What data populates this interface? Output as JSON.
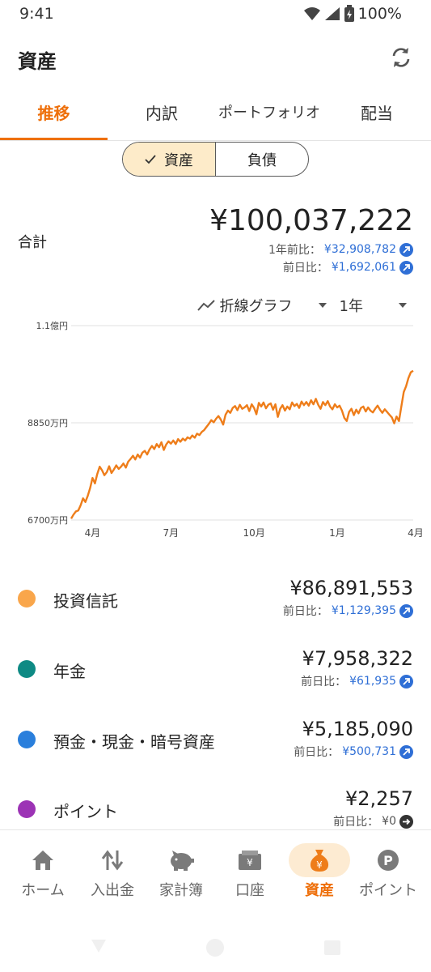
{
  "status_bar": {
    "time": "9:41",
    "battery": "100%"
  },
  "header": {
    "title": "資産"
  },
  "tabs": [
    {
      "label": "推移",
      "active": true
    },
    {
      "label": "内訳",
      "active": false
    },
    {
      "label": "ポートフォリオ",
      "active": false
    },
    {
      "label": "配当",
      "active": false
    }
  ],
  "segment": {
    "assets_label": "資産",
    "liabilities_label": "負債",
    "selected": "資産"
  },
  "summary": {
    "total_label": "合計",
    "total_value": "¥100,037,222",
    "yoy_label": "1年前比：",
    "yoy_value": "¥32,908,782",
    "dod_label": "前日比：",
    "dod_value": "¥1,692,061"
  },
  "chart_controls": {
    "chart_type": "折線グラフ",
    "period": "1年"
  },
  "chart_data": {
    "type": "line",
    "y_ticks": [
      {
        "label": "1.1億円",
        "value": 110000000
      },
      {
        "label": "8850万円",
        "value": 88500000
      },
      {
        "label": "6700万円",
        "value": 67000000
      }
    ],
    "ylim": [
      67000000,
      110000000
    ],
    "x_ticks": [
      "4月",
      "7月",
      "10月",
      "1月",
      "4月"
    ],
    "x_tick_index": [
      9,
      42,
      77,
      112,
      145
    ],
    "series": [
      {
        "color": "#ee7d1a",
        "values": [
          67.3,
          68.2,
          68.9,
          69.1,
          70.3,
          71.8,
          71.0,
          72.4,
          74.1,
          76.3,
          75.1,
          77.2,
          78.8,
          78.0,
          76.9,
          77.6,
          78.9,
          77.4,
          78.2,
          79.1,
          78.3,
          78.8,
          79.5,
          78.6,
          79.9,
          80.5,
          81.2,
          80.4,
          81.5,
          80.8,
          81.9,
          82.3,
          81.5,
          82.6,
          83.4,
          82.7,
          83.8,
          83.1,
          84.2,
          82.5,
          83.7,
          84.4,
          83.9,
          84.6,
          83.8,
          84.9,
          84.3,
          85.0,
          84.6,
          85.3,
          85.0,
          85.7,
          85.2,
          86.1,
          85.8,
          86.5,
          86.9,
          87.6,
          88.3,
          89.1,
          88.6,
          89.4,
          90.0,
          89.2,
          88.1,
          90.3,
          91.2,
          90.7,
          91.8,
          92.2,
          91.3,
          92.5,
          91.6,
          91.9,
          92.4,
          91.1,
          92.6,
          91.8,
          90.4,
          92.9,
          92.1,
          93.0,
          91.7,
          92.5,
          92.8,
          91.4,
          92.6,
          89.8,
          91.6,
          92.4,
          91.2,
          92.1,
          91.5,
          93.0,
          92.2,
          92.7,
          91.8,
          93.2,
          92.4,
          93.1,
          92.3,
          93.5,
          92.6,
          93.8,
          92.5,
          91.6,
          93.1,
          92.4,
          93.3,
          92.1,
          91.5,
          92.6,
          91.9,
          92.3,
          91.2,
          89.6,
          88.9,
          90.9,
          91.6,
          90.2,
          91.4,
          90.6,
          91.8,
          92.1,
          91.0,
          91.9,
          91.2,
          90.8,
          91.6,
          92.3,
          91.4,
          90.7,
          91.5,
          90.9,
          90.3,
          89.7,
          88.4,
          89.9,
          88.9,
          92.1,
          95.3,
          96.6,
          98.4,
          99.7,
          100.0
        ]
      }
    ]
  },
  "assets": [
    {
      "name": "投資信託",
      "amount": "¥86,891,553",
      "delta_label": "前日比：",
      "delta_value": "¥1,129,395",
      "color": "#f9a64b",
      "trend": "up"
    },
    {
      "name": "年金",
      "amount": "¥7,958,322",
      "delta_label": "前日比：",
      "delta_value": "¥61,935",
      "color": "#0e8a84",
      "trend": "up"
    },
    {
      "name": "預金・現金・暗号資産",
      "amount": "¥5,185,090",
      "delta_label": "前日比：",
      "delta_value": "¥500,731",
      "color": "#2a7fdc",
      "trend": "up"
    },
    {
      "name": "ポイント",
      "amount": "¥2,257",
      "delta_label": "前日比：",
      "delta_value": "¥0",
      "color": "#9c33b5",
      "trend": "flat"
    }
  ],
  "bottom_nav": [
    {
      "label": "ホーム",
      "icon": "home-icon"
    },
    {
      "label": "入出金",
      "icon": "transfer-icon"
    },
    {
      "label": "家計簿",
      "icon": "piggy-bank-icon"
    },
    {
      "label": "口座",
      "icon": "wallet-icon"
    },
    {
      "label": "資産",
      "icon": "money-bag-icon",
      "active": true
    },
    {
      "label": "ポイント",
      "icon": "point-icon"
    }
  ],
  "colors": {
    "accent": "#ee6f0a",
    "link_blue": "#2f6fd6",
    "chart_line": "#ee7d1a"
  }
}
